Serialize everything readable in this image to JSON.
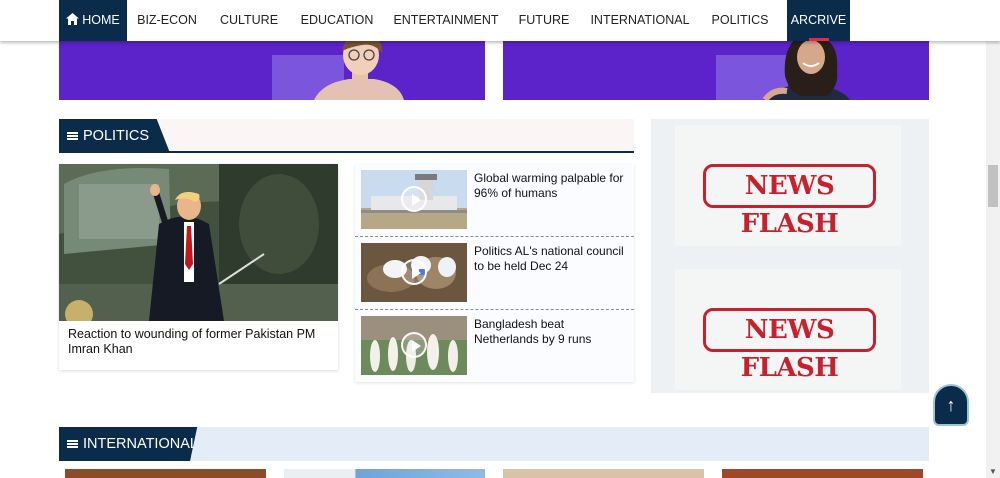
{
  "nav": {
    "home": "HOME",
    "items": [
      "BIZ-ECON",
      "CULTURE",
      "EDUCATION",
      "ENTERTAINMENT",
      "FUTURE",
      "INTERNATIONAL",
      "POLITICS"
    ],
    "archive": "ARCRIVE"
  },
  "politics": {
    "heading": "POLITICS",
    "lead": {
      "title": "Reaction to wounding of former Pakistan PM Imran Khan"
    },
    "list": [
      {
        "title": "Global warming palpable for 96% of humans"
      },
      {
        "title": "Politics AL's national council to be held Dec 24"
      },
      {
        "title": "Bangladesh beat Netherlands by 9 runs"
      }
    ]
  },
  "ads": {
    "stamp_text": "NEWS FLASH"
  },
  "international": {
    "heading": "INTERNATIONAL"
  },
  "back_to_top": "↑",
  "colors": {
    "navy": "#0b2b4a",
    "purple": "#5b23c9",
    "stamp_red": "#c8202c"
  }
}
